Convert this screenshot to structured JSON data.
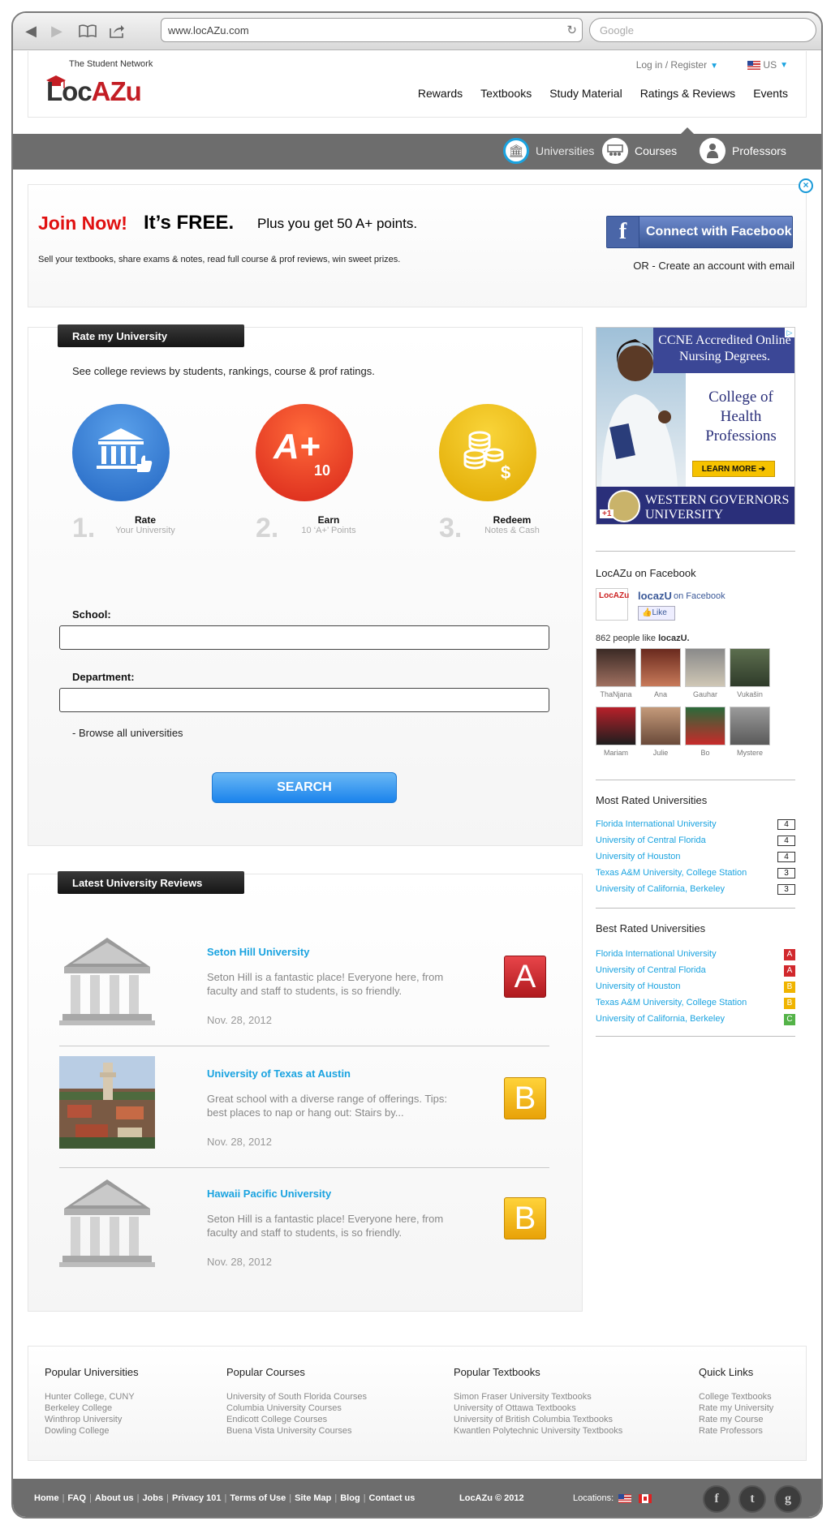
{
  "browser": {
    "url": "www.locAZu.com",
    "search_placeholder": "Google"
  },
  "header": {
    "tagline": "The Student Network",
    "logo_text": "LocAZu",
    "login": "Log in / Register",
    "locale": "US",
    "nav": [
      "Rewards",
      "Textbooks",
      "Study Material",
      "Ratings & Reviews",
      "Events"
    ]
  },
  "subnav": [
    {
      "label": "Universities",
      "icon": "university-icon",
      "active": true
    },
    {
      "label": "Courses",
      "icon": "courses-icon",
      "active": false
    },
    {
      "label": "Professors",
      "icon": "professors-icon",
      "active": false
    }
  ],
  "join": {
    "join_now": "Join Now!",
    "free": "It’s FREE.",
    "plus": "Plus you get 50 A+ points.",
    "sub": "Sell your textbooks, share exams & notes, read full course & prof reviews, win sweet prizes.",
    "fb_button": "Connect with Facebook",
    "or_create": "OR - Create an account with email"
  },
  "rate": {
    "tab": "Rate my University",
    "intro": "See college reviews by students, rankings, course & prof ratings.",
    "steps": [
      {
        "num": "1.",
        "title": "Rate",
        "sub": "Your University",
        "icon": "university-thumb-icon",
        "color": "#2f7fd1"
      },
      {
        "num": "2.",
        "title": "Earn",
        "sub": "10 ‘A+’ Points",
        "icon": "a-plus-icon",
        "color": "#e8361a",
        "big": "A+",
        "small": "10"
      },
      {
        "num": "3.",
        "title": "Redeem",
        "sub": "Notes & Cash",
        "icon": "coins-icon",
        "color": "#eab606"
      }
    ],
    "school_label": "School:",
    "department_label": "Department:",
    "browse": "- Browse all universities",
    "search_button": "SEARCH"
  },
  "reviews": {
    "tab": "Latest University Reviews",
    "items": [
      {
        "name": "Seton Hill University",
        "text": "Seton Hill is a fantastic place! Everyone here, from faculty and staff to students, is so friendly.",
        "date": "Nov. 28, 2012",
        "grade": "A",
        "thumb": "building-icon"
      },
      {
        "name": "University of Texas at Austin",
        "text": "Great school with a diverse range of offerings. Tips: best places to nap or hang out: Stairs by...",
        "date": "Nov. 28, 2012",
        "grade": "B",
        "thumb": "campus-photo"
      },
      {
        "name": "Hawaii Pacific University",
        "text": "Seton Hill is a fantastic place! Everyone here, from faculty and staff to students, is so friendly.",
        "date": "Nov. 28, 2012",
        "grade": "B",
        "thumb": "building-icon"
      }
    ]
  },
  "ad": {
    "top": "CCNE Accredited Online Nursing Degrees.",
    "college": "College of Health Professions",
    "learn": "LEARN MORE ➔",
    "bottom": "WESTERN GOVERNORS UNIVERSITY",
    "gplus": "+1"
  },
  "facebook": {
    "heading": "LocAZu on Facebook",
    "page_name": "locazU",
    "on_facebook": "on Facebook",
    "like": "Like",
    "count_text": "862 people like",
    "count_name": "locazU.",
    "fans": [
      "ThaNjana",
      "Ana",
      "Gauhar",
      "Vukašin",
      "Mariam",
      "Julie",
      "Bo",
      "Mystere"
    ]
  },
  "most_rated": {
    "heading": "Most Rated Universities",
    "items": [
      {
        "name": "Florida International University",
        "count": "4"
      },
      {
        "name": "University of Central Florida",
        "count": "4"
      },
      {
        "name": "University of Houston",
        "count": "4"
      },
      {
        "name": "Texas A&M University, College Station",
        "count": "3"
      },
      {
        "name": "University of California, Berkeley",
        "count": "3"
      }
    ]
  },
  "best_rated": {
    "heading": "Best Rated Universities",
    "items": [
      {
        "name": "Florida International University",
        "grade": "A"
      },
      {
        "name": "University of Central Florida",
        "grade": "A"
      },
      {
        "name": "University of Houston",
        "grade": "B"
      },
      {
        "name": "Texas A&M University, College Station",
        "grade": "B"
      },
      {
        "name": "University of California, Berkeley",
        "grade": "C"
      }
    ]
  },
  "link_columns": [
    {
      "heading": "Popular Universities",
      "items": [
        "Hunter College, CUNY",
        "Berkeley College",
        "Winthrop University",
        "Dowling College"
      ]
    },
    {
      "heading": "Popular Courses",
      "items": [
        "University of South Florida Courses",
        "Columbia University Courses",
        "Endicott College Courses",
        "Buena Vista University Courses"
      ]
    },
    {
      "heading": "Popular Textbooks",
      "items": [
        "Simon Fraser University Textbooks",
        "University of Ottawa Textbooks",
        "University of British Columbia Textbooks",
        "Kwantlen Polytechnic University Textbooks"
      ]
    },
    {
      "heading": "Quick Links",
      "items": [
        "College Textbooks",
        "Rate my University",
        "Rate my Course",
        "Rate Professors"
      ]
    }
  ],
  "footer": {
    "links": [
      "Home",
      "FAQ",
      "About us",
      "Jobs",
      "Privacy 101",
      "Terms of Use",
      "Site Map",
      "Blog",
      "Contact us"
    ],
    "copyright": "LocAZu © 2012",
    "locations": "Locations:",
    "social": [
      {
        "icon": "facebook-icon",
        "glyph": "f"
      },
      {
        "icon": "twitter-icon",
        "glyph": "t"
      },
      {
        "icon": "google-icon",
        "glyph": "g"
      }
    ]
  }
}
